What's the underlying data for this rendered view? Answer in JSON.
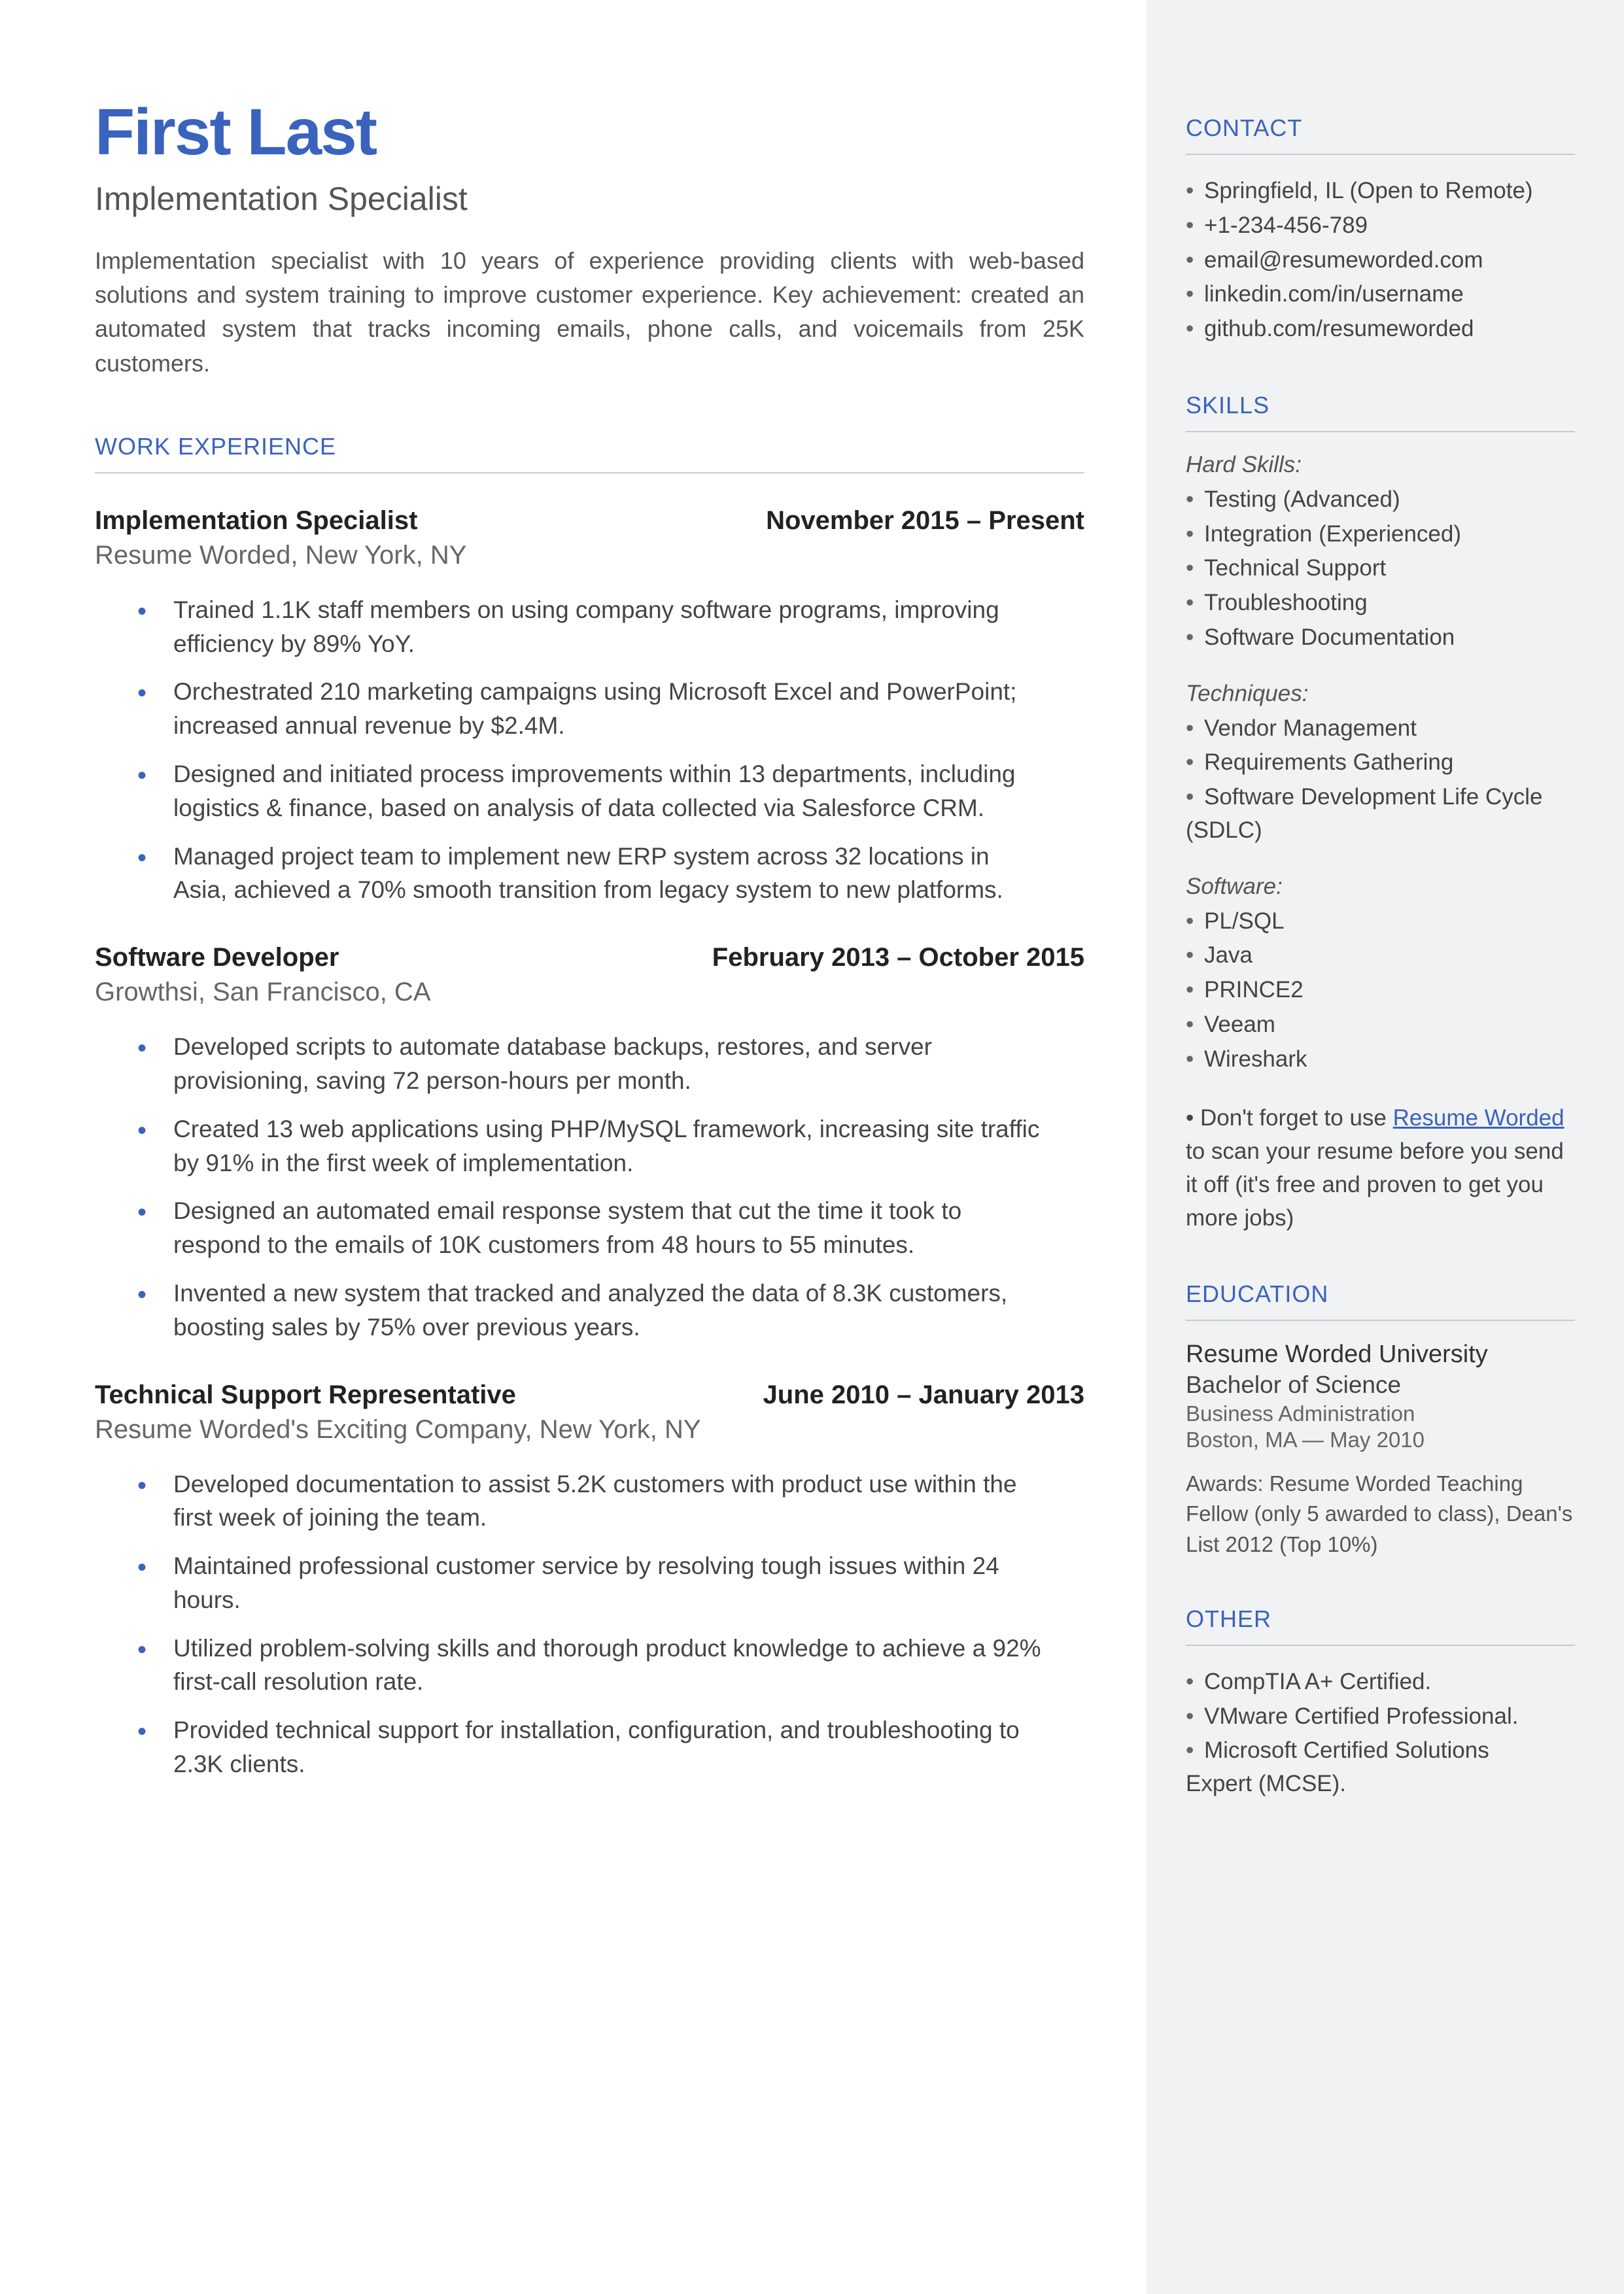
{
  "name": "First Last",
  "title": "Implementation Specialist",
  "summary": "Implementation specialist with 10 years of experience providing clients with web-based solutions and system training to improve customer experience. Key achievement: created an automated system that tracks incoming emails, phone calls, and voicemails from 25K customers.",
  "labels": {
    "work": "WORK EXPERIENCE",
    "contact": "CONTACT",
    "skills": "SKILLS",
    "education": "EDUCATION",
    "other": "OTHER"
  },
  "jobs": [
    {
      "role": "Implementation Specialist",
      "dates": "November 2015 – Present",
      "company": "Resume Worded, New York, NY",
      "bullets": [
        "Trained 1.1K staff members on using company software programs, improving efficiency by 89% YoY.",
        "Orchestrated 210 marketing campaigns using Microsoft Excel and PowerPoint; increased annual revenue by $2.4M.",
        "Designed and initiated process improvements within  13 departments, including logistics & finance, based on analysis of data collected via Salesforce CRM.",
        "Managed project team to implement new ERP system across 32 locations in Asia, achieved a 70% smooth transition from legacy system to new platforms."
      ]
    },
    {
      "role": "Software Developer",
      "dates": "February 2013 – October 2015",
      "company": "Growthsi, San Francisco, CA",
      "bullets": [
        "Developed scripts to automate database backups, restores, and server provisioning, saving 72 person-hours per month.",
        "Created 13 web applications using PHP/MySQL framework, increasing site traffic by 91% in the first week of implementation.",
        "Designed an automated email response system that cut the time it took to respond to the emails of 10K customers from 48 hours to 55 minutes.",
        "Invented a new system that tracked and analyzed the data of 8.3K customers, boosting sales by 75% over previous years."
      ]
    },
    {
      "role": "Technical Support Representative",
      "dates": "June 2010 – January 2013",
      "company": "Resume Worded's Exciting Company, New York, NY",
      "bullets": [
        "Developed documentation to assist 5.2K customers with product use within the first week of joining the team.",
        "Maintained professional customer service by resolving tough issues within 24 hours.",
        "Utilized problem-solving skills and thorough product knowledge to achieve a 92% first-call resolution rate.",
        "Provided technical support for installation, configuration, and troubleshooting to 2.3K clients."
      ]
    }
  ],
  "contact": [
    "Springfield, IL (Open to Remote)",
    "+1-234-456-789",
    "email@resumeworded.com",
    "linkedin.com/in/username",
    "github.com/resumeworded"
  ],
  "skills": {
    "hard_label": "Hard Skills:",
    "hard": [
      "Testing (Advanced)",
      "Integration (Experienced)",
      "Technical Support",
      "Troubleshooting",
      "Software Documentation"
    ],
    "tech_label": "Techniques:",
    "tech": [
      "Vendor Management",
      "Requirements Gathering",
      "Software Development Life Cycle (SDLC)"
    ],
    "soft_label": "Software:",
    "soft": [
      "PL/SQL",
      "Java",
      "PRINCE2",
      "Veeam",
      "Wireshark"
    ],
    "note_pre": "Don't forget to use ",
    "note_link": "Resume Worded",
    "note_post": " to scan your resume before you send it off (it's free and proven to get you more jobs)"
  },
  "education": {
    "school": "Resume Worded University",
    "degree": "Bachelor of Science",
    "field": "Business Administration",
    "loc": "Boston, MA — May 2010",
    "awards": "Awards: Resume Worded Teaching Fellow (only 5 awarded to class), Dean's List 2012 (Top 10%)"
  },
  "other": [
    "CompTIA A+ Certified.",
    "VMware Certified Professional.",
    "Microsoft Certified Solutions Expert (MCSE)."
  ]
}
